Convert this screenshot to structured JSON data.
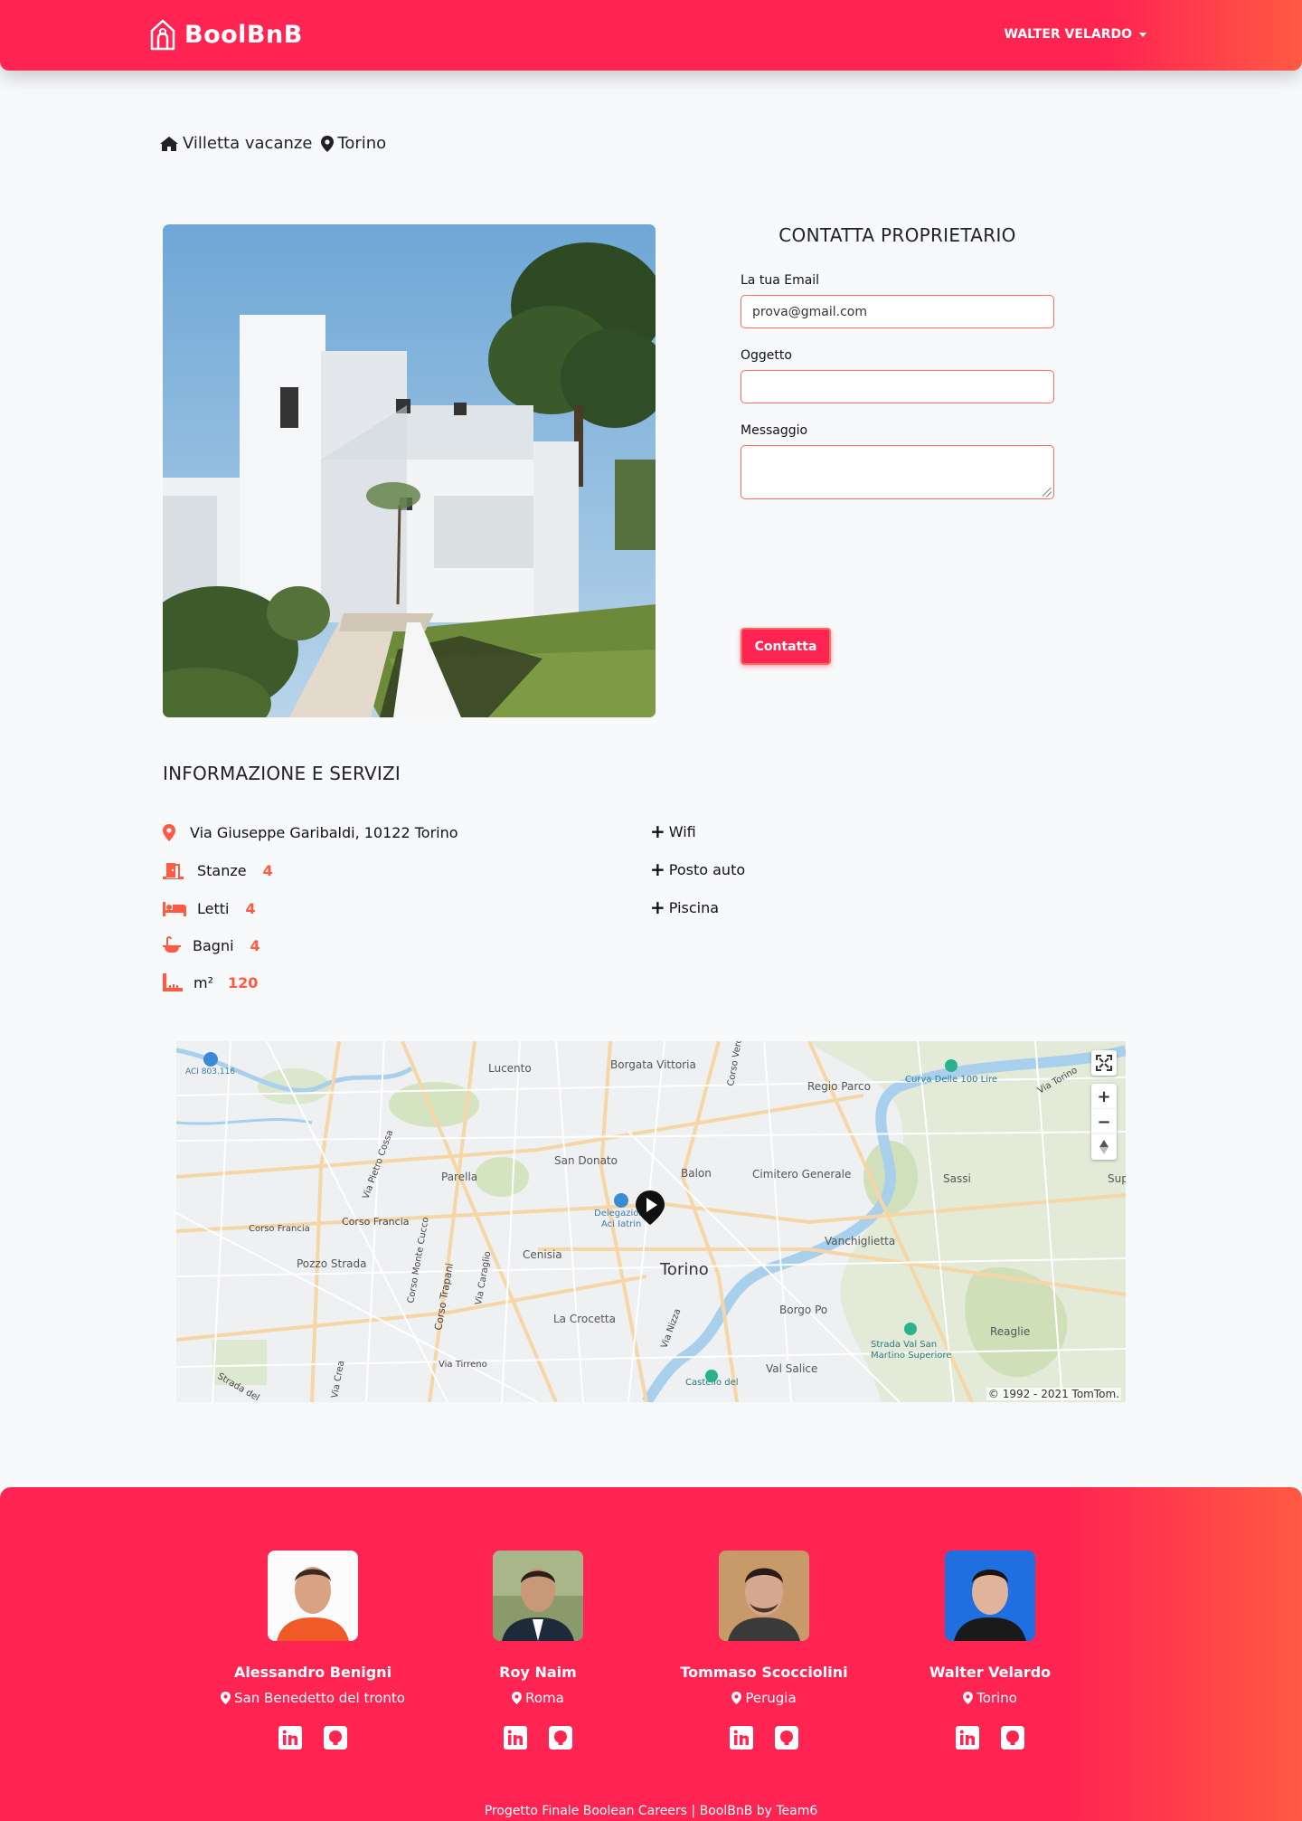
{
  "navbar": {
    "brand": "BoolBnB",
    "user": "WALTER VELARDO"
  },
  "breadcrumb": {
    "type": "Villetta vacanze",
    "city": "Torino"
  },
  "contact": {
    "title": "CONTATTA PROPRIETARIO",
    "email_label": "La tua Email",
    "email_value": "prova@gmail.com",
    "subject_label": "Oggetto",
    "subject_value": "",
    "message_label": "Messaggio",
    "message_value": "",
    "submit_label": "Contatta"
  },
  "info": {
    "title": "INFORMAZIONE E SERVIZI",
    "address": "Via Giuseppe Garibaldi, 10122 Torino",
    "rooms_label": "Stanze",
    "rooms": "4",
    "beds_label": "Letti",
    "beds": "4",
    "baths_label": "Bagni",
    "baths": "4",
    "sqm_label": "m²",
    "sqm": "120",
    "services": [
      "Wifi",
      "Posto auto",
      "Piscina"
    ]
  },
  "map": {
    "labels": [
      "Lucento",
      "Borgata Vittoria",
      "Regio Parco",
      "Curva Delle 100 Lire",
      "Via Torino",
      "San Donato",
      "Parella",
      "Balon",
      "Cimitero Generale",
      "Sassi",
      "Delegazione Aci Iatrin",
      "Corso Francia",
      "Corso Francia",
      "Vanchiglietta",
      "Pozzo Strada",
      "Cenisia",
      "Torino",
      "La Crocetta",
      "Borgo Po",
      "Reaglie",
      "Strada Val San Martino Superiore",
      "Val Salice",
      "Castello del Valentino",
      "Via Tirreno",
      "ACI 803.116",
      "Via Pietro Cossa",
      "Corso Monte Cucco",
      "Corso Trapani",
      "Via Caraglio",
      "Via Nizza",
      "Corso Vercelli",
      "Via Crea",
      "Strada del",
      "Sup"
    ],
    "zoom_in": "+",
    "zoom_out": "−",
    "copyright": "© 1992 - 2021 TomTom."
  },
  "footer": {
    "members": [
      {
        "name": "Alessandro Benigni",
        "city": "San Benedetto del tronto"
      },
      {
        "name": "Roy Naim",
        "city": "Roma"
      },
      {
        "name": "Tommaso Scocciolini",
        "city": "Perugia"
      },
      {
        "name": "Walter Velardo",
        "city": "Torino"
      }
    ],
    "credit": "Progetto Finale Boolean Careers | BoolBnB by Team6"
  },
  "colors": {
    "brand": "#ff2452",
    "accent": "#ff5a43"
  }
}
